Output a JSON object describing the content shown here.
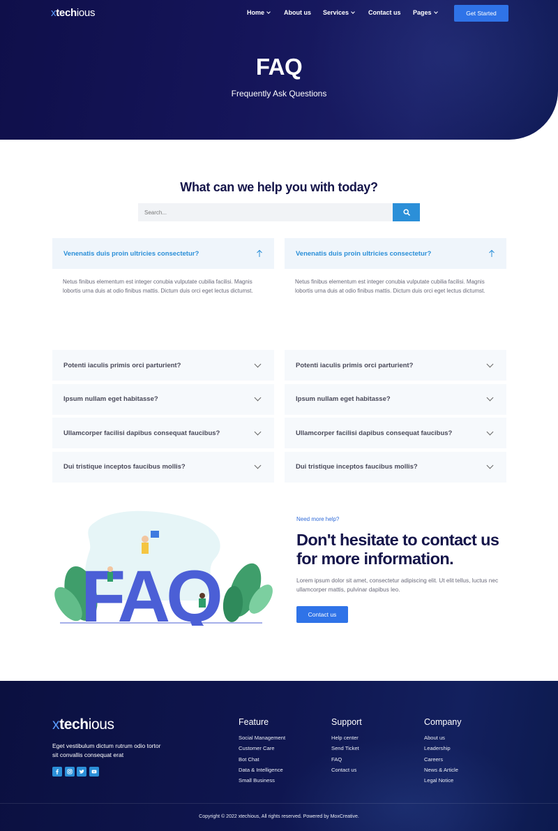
{
  "brand": {
    "prefix": "x",
    "bold": "tech",
    "suffix": "ious"
  },
  "nav": {
    "items": [
      {
        "label": "Home",
        "dropdown": true
      },
      {
        "label": "About us",
        "dropdown": false
      },
      {
        "label": "Services",
        "dropdown": true
      },
      {
        "label": "Contact us",
        "dropdown": false
      },
      {
        "label": "Pages",
        "dropdown": true
      }
    ],
    "cta": "Get Started"
  },
  "hero": {
    "title": "FAQ",
    "subtitle": "Frequently Ask Questions"
  },
  "faq": {
    "heading": "What can we help you with today?",
    "search_placeholder": "Search...",
    "columns": [
      {
        "open": {
          "question": "Venenatis duis proin ultricies consectetur?",
          "answer": "Netus finibus elementum est integer conubia vulputate cubilia facilisi. Magnis lobortis urna duis at odio finibus mattis. Dictum duis orci eget lectus dictumst."
        },
        "items": [
          "Potenti iaculis primis orci parturient?",
          "Ipsum nullam eget habitasse?",
          "Ullamcorper facilisi dapibus consequat faucibus?",
          "Dui tristique inceptos faucibus mollis?"
        ]
      },
      {
        "open": {
          "question": "Venenatis duis proin ultricies consectetur?",
          "answer": "Netus finibus elementum est integer conubia vulputate cubilia facilisi. Magnis lobortis urna duis at odio finibus mattis. Dictum duis orci eget lectus dictumst."
        },
        "items": [
          "Potenti iaculis primis orci parturient?",
          "Ipsum nullam eget habitasse?",
          "Ullamcorper facilisi dapibus consequat faucibus?",
          "Dui tristique inceptos faucibus mollis?"
        ]
      }
    ]
  },
  "contact": {
    "eyebrow": "Need more help?",
    "title": "Don't hesitate to contact us for more information.",
    "text": "Lorem ipsum dolor sit amet, consectetur adipiscing elit. Ut elit tellus, luctus nec ullamcorper mattis, pulvinar dapibus leo.",
    "button": "Contact us",
    "illustration_text": "FAQ"
  },
  "footer": {
    "description": "Eget vestibulum dictum rutrum odio tortor sit convallis consequat erat",
    "socials": [
      "facebook-icon",
      "instagram-icon",
      "twitter-icon",
      "youtube-icon"
    ],
    "columns": [
      {
        "title": "Feature",
        "links": [
          "Social Management",
          "Customer Care",
          "Bot Chat",
          "Data & Intelligence",
          "Small Business"
        ]
      },
      {
        "title": "Support",
        "links": [
          "Help center",
          "Send Ticket",
          "FAQ",
          "Contact us"
        ]
      },
      {
        "title": "Company",
        "links": [
          "About us",
          "Leadership",
          "Careers",
          "News & Article",
          "Legal Notice"
        ]
      }
    ],
    "copyright": "Copyright © 2022 xtechious, All rights reserved. Powered by MoxCreative."
  },
  "colors": {
    "accent": "#2f73e8",
    "link_blue": "#2b8fd8",
    "navy": "#15154a"
  }
}
